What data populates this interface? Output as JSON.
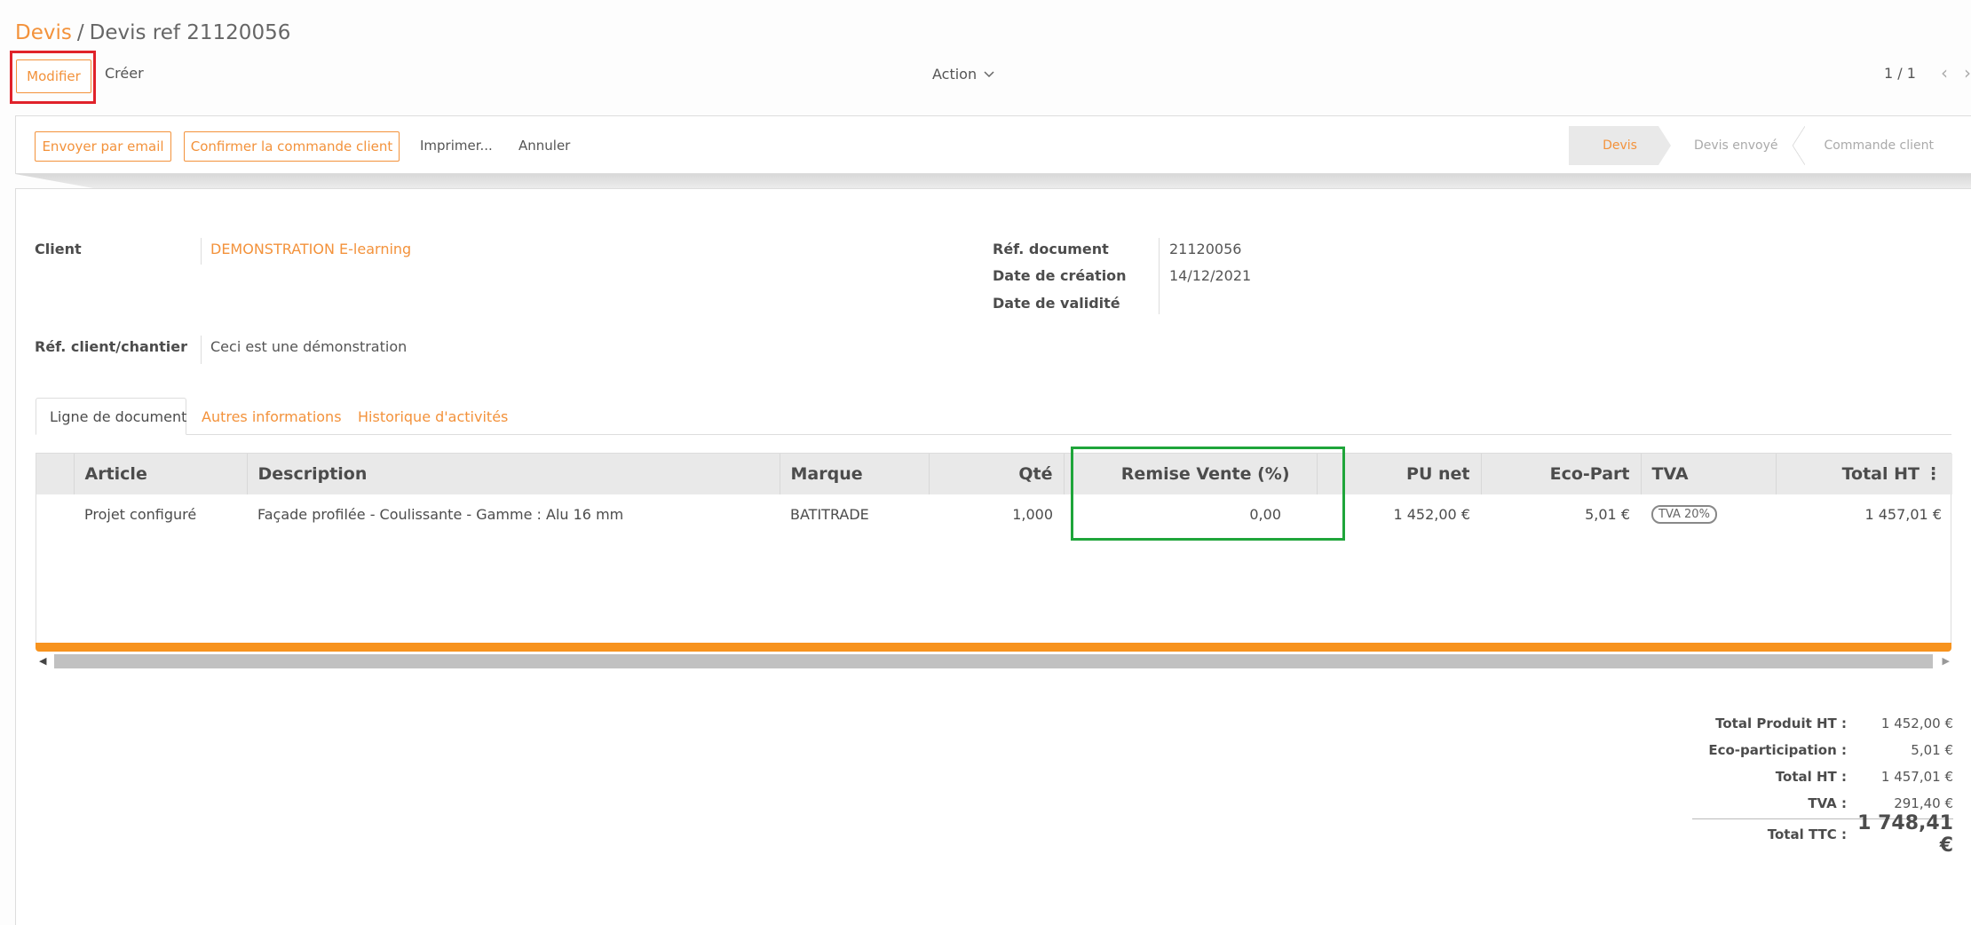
{
  "breadcrumb": {
    "parent": "Devis",
    "separator": "/",
    "current": "Devis ref 21120056"
  },
  "control_panel": {
    "edit_label": "Modifier",
    "create_label": "Créer",
    "action_label": "Action",
    "pager": "1 / 1"
  },
  "header_buttons": {
    "send_email": "Envoyer par email",
    "confirm_order": "Confirmer la commande client",
    "print": "Imprimer...",
    "cancel": "Annuler"
  },
  "statusbar": [
    {
      "label": "Devis",
      "active": true
    },
    {
      "label": "Devis envoyé",
      "active": false
    },
    {
      "label": "Commande client",
      "active": false
    }
  ],
  "form": {
    "client_label": "Client",
    "client_value": "DEMONSTRATION E-learning",
    "client_ref_label": "Réf. client/chantier",
    "client_ref_value": "Ceci est une démonstration",
    "doc_ref_label": "Réf. document",
    "doc_ref_value": "21120056",
    "creation_date_label": "Date de création",
    "creation_date_value": "14/12/2021",
    "validity_date_label": "Date de validité",
    "validity_date_value": ""
  },
  "tabs": [
    {
      "label": "Ligne de document",
      "active": true
    },
    {
      "label": "Autres informations",
      "active": false
    },
    {
      "label": "Historique d'activités",
      "active": false
    }
  ],
  "table": {
    "columns": [
      "",
      "Article",
      "Description",
      "Marque",
      "Qté",
      "Remise Vente (%)",
      "PU net",
      "Eco-Part",
      "TVA",
      "Total HT"
    ],
    "rows": [
      {
        "article": "Projet configuré",
        "description": "Façade profilée - Coulissante - Gamme : Alu 16 mm",
        "brand": "BATITRADE",
        "qty": "1,000",
        "discount": "0,00",
        "unit_price": "1 452,00 €",
        "eco_part": "5,01 €",
        "tax": "TVA 20%",
        "total_ht": "1 457,01 €"
      }
    ]
  },
  "totals": [
    {
      "label": "Total Produit HT :",
      "value": "1 452,00 €"
    },
    {
      "label": "Eco-participation :",
      "value": "5,01 €"
    },
    {
      "label": "Total HT :",
      "value": "1 457,01 €"
    },
    {
      "label": "TVA :",
      "value": "291,40 €"
    }
  ],
  "grand_total": {
    "label": "Total TTC :",
    "value": "1 748,41 €"
  },
  "colors": {
    "accent": "#f3923b",
    "highlight_red": "#e0222a",
    "highlight_green": "#1fa53a",
    "progress_bar": "#f7931e"
  }
}
